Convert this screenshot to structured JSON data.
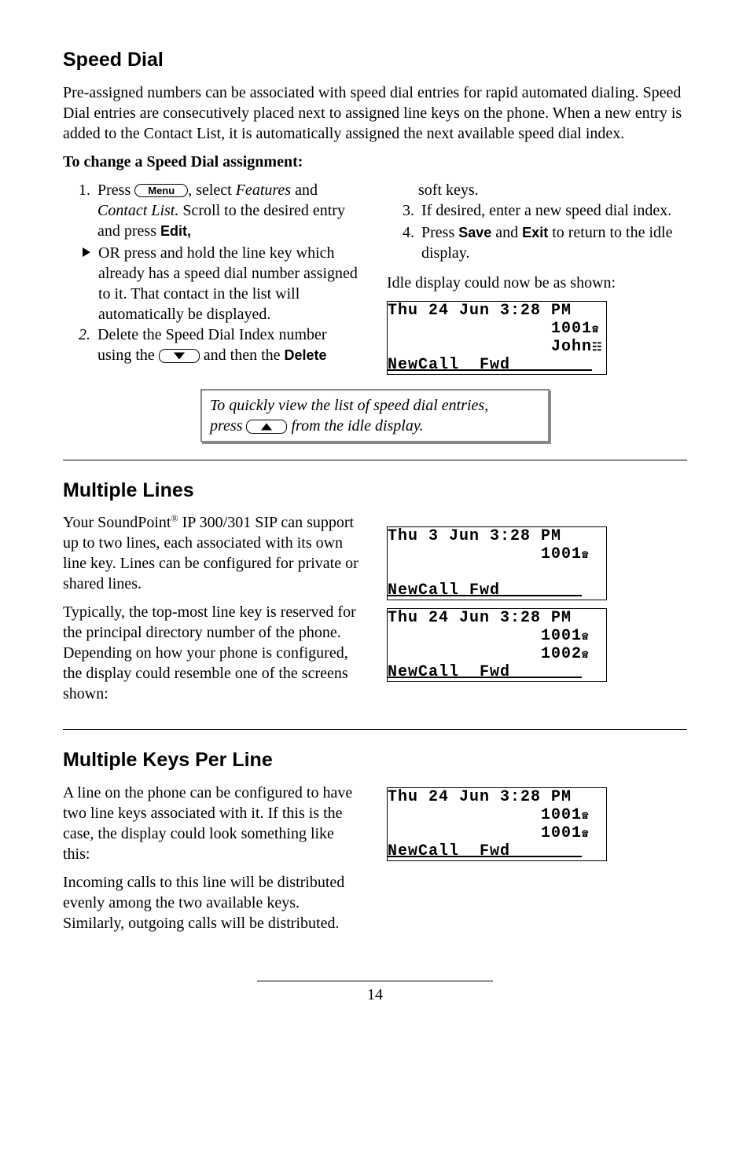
{
  "s1": {
    "heading": "Speed Dial",
    "intro": "Pre-assigned numbers can be associated with speed dial entries for rapid automated dialing. Speed Dial entries are consecutively placed next to assigned line keys on the phone.  When a new entry is added to the Contact List, it is automatically assigned the next available speed dial index.",
    "sub": "To change a Speed Dial assignment:",
    "l1a": "Press ",
    "menu": "Menu",
    "l1b": ", select ",
    "features": "Features",
    "l1c": " and ",
    "contact": "Contact List.",
    "l1d": "  Scroll to the desired entry and press ",
    "edit": "Edit,",
    "l2a": "OR press and hold the line key which already has a speed dial number assigned to it.  That contact in the list will automatically be displayed.",
    "l3a": "Delete the Speed Dial Index number using the ",
    "l3b": " and then the ",
    "delete": "Delete",
    "r1": "soft keys.",
    "r2": "If desired, enter a new speed dial index.",
    "r3a": "Press ",
    "save": "Save",
    "r3b": " and ",
    "exit": "Exit",
    "r3c": " to return to the idle display.",
    "idle": "Idle display could now be as shown:",
    "lcd_l1": "Thu 24 Jun 3:28 PM   ",
    "lcd_l2": "                1001",
    "lcd_l3": "                John",
    "lcd_l4": "NewCall  Fwd        ",
    "tip1": "To quickly view the list of speed dial entries,",
    "tip2a": "press ",
    "tip2b": " from the idle display."
  },
  "s2": {
    "heading": "Multiple Lines",
    "p1a": "Your SoundPoint",
    "sup": "®",
    "p1b": " IP 300/301 SIP can support up to two lines, each associated with its own line key.  Lines can be configured for private or shared lines.",
    "p2": "Typically, the top-most line key is reserved for the principal directory number of the phone.  Depending on how your phone is configured, the display could resemble one of the screens shown:",
    "lcd1_l1": "Thu 3 Jun 3:28 PM   ",
    "lcd1_l2": "               1001",
    "lcd1_l3": "                    ",
    "lcd1_l4": "NewCall Fwd        ",
    "lcd2_l1": "Thu 24 Jun 3:28 PM  ",
    "lcd2_l2": "               1001",
    "lcd2_l3": "               1002",
    "lcd2_l4": "NewCall  Fwd       "
  },
  "s3": {
    "heading": "Multiple Keys Per Line",
    "p1": "A line on the phone can be configured to have two line keys associated with it.  If this is the case, the display could look something like this:",
    "p2": "Incoming calls to this line will be distributed evenly among the two available keys.  Similarly, outgoing calls will be distributed.",
    "lcd_l1": "Thu 24 Jun 3:28 PM  ",
    "lcd_l2": "               1001",
    "lcd_l3": "               1001",
    "lcd_l4": "NewCall  Fwd       "
  },
  "page": "14"
}
